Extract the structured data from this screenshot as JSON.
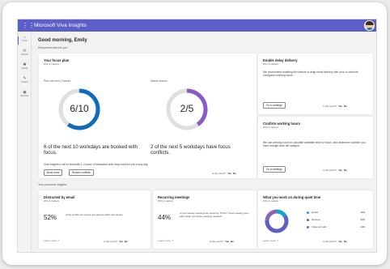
{
  "app": {
    "title": "Microsoft Viva Insights"
  },
  "rail": {
    "items": [
      {
        "label": "Home",
        "icon": "home-icon",
        "glyph": "⌂"
      },
      {
        "label": "Refresh",
        "icon": "refresh-icon",
        "glyph": "⟳"
      },
      {
        "label": "Activity",
        "icon": "activity-icon",
        "glyph": "✺"
      },
      {
        "label": "Protect",
        "icon": "protect-icon",
        "glyph": "✎"
      },
      {
        "label": "Discover",
        "icon": "discover-icon",
        "glyph": "◉"
      }
    ]
  },
  "greeting": "Good morning, Emily",
  "recommended": {
    "label": "Recommended for you",
    "focus_plan": {
      "title": "Your focus plan",
      "sub": "Why it matters",
      "left_label": "Plan the next 2 weeks",
      "right_label": "Needs review",
      "ring1_text": "6/10",
      "ring1_value": 0.6,
      "ring2_text": "2/5",
      "ring2_value": 0.4,
      "desc1": "6 of the next 10 workdays are booked with focus.",
      "desc2": "2 of the next 5 workdays have focus conflicts.",
      "note": "Viva Insights is set to schedule 1-4 hours of distraction-free deep work for you every day.",
      "book_more": "Book more",
      "review_conflicts": "Review conflicts",
      "useful_q": "Is this useful?",
      "yes": "Yes",
      "no": "No"
    },
    "delay_delivery": {
      "title": "Enable delay delivery",
      "sub": "Why it matters",
      "body": "We recommend enabling this feature to align email delivery with your co-workers' configured working hours.",
      "button": "Go to settings",
      "useful_q": "Is this useful?",
      "yes": "Yes",
      "no": "No"
    },
    "working_hours": {
      "title": "Confirm working hours",
      "sub": "Why it matters",
      "body": "We use working hours to calculate available time for focus, and determine whether you have enough work-life balance.",
      "button": "Go to settings",
      "useful_q": "Is this useful?",
      "yes": "Yes",
      "no": "No"
    }
  },
  "personal": {
    "label": "Your personal insights",
    "distracted": {
      "title": "Distracted by email",
      "sub": "Why it matters",
      "pct": "52%",
      "text": "of the emails you receive are opened within 10 minutes",
      "link": "Learn more",
      "useful_q": "Is this useful?",
      "yes": "Yes",
      "no": "No"
    },
    "recurring": {
      "title": "Recurring meetings",
      "sub": "Why it matters",
      "pct": "44%",
      "text": "of your weekly meetings are recurring. That's 7 hours weekly given each week. Are those meetings needed?",
      "link": "Learn more",
      "useful_q": "Is this useful?",
      "yes": "Yes",
      "no": "No"
    },
    "quiet_time": {
      "title": "What you work on during quiet time",
      "sub": "Why it matters",
      "legend": [
        {
          "name": "Emails",
          "value": "16%",
          "color": "#0fa5d6"
        },
        {
          "name": "Meetings",
          "value": "60%",
          "color": "#5b5fc7"
        },
        {
          "name": "Chats and calls",
          "value": "24%",
          "color": "#8764b8"
        }
      ],
      "link": "Learn more",
      "useful_q": "Is this useful?",
      "yes": "Yes",
      "no": "No"
    }
  },
  "colors": {
    "accent": "#5b5fc7",
    "ring_focus": "#0f6cbd",
    "ring_conflict": "#8a59c9"
  }
}
